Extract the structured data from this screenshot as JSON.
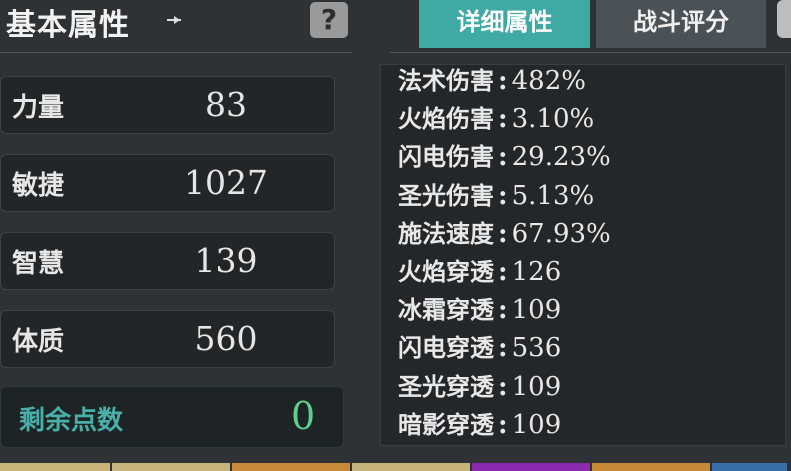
{
  "header": {
    "title": "基本属性"
  },
  "tabs": [
    {
      "label": "详细属性",
      "active": true
    },
    {
      "label": "战斗评分",
      "active": false
    }
  ],
  "base_stats": [
    {
      "label": "力量",
      "value": "83"
    },
    {
      "label": "敏捷",
      "value": "1027"
    },
    {
      "label": "智慧",
      "value": "139"
    },
    {
      "label": "体质",
      "value": "560"
    }
  ],
  "remaining_points": {
    "label": "剩余点数",
    "value": "0"
  },
  "detail_stats": [
    {
      "label": "法术伤害",
      "value": "482%"
    },
    {
      "label": "火焰伤害",
      "value": "3.10%"
    },
    {
      "label": "闪电伤害",
      "value": "29.23%"
    },
    {
      "label": "圣光伤害",
      "value": "5.13%"
    },
    {
      "label": "施法速度",
      "value": "67.93%"
    },
    {
      "label": "火焰穿透",
      "value": "126"
    },
    {
      "label": "冰霜穿透",
      "value": "109"
    },
    {
      "label": "闪电穿透",
      "value": "536"
    },
    {
      "label": "圣光穿透",
      "value": "109"
    },
    {
      "label": "暗影穿透",
      "value": "109"
    }
  ],
  "detail_separator": ":",
  "icons": {
    "pin": "pin-icon",
    "help": "help-icon"
  },
  "help_glyph": "?",
  "colors": {
    "accent": "#3fa9a3",
    "remain_value": "#5fd08c",
    "remain_label": "#48b0a8"
  }
}
